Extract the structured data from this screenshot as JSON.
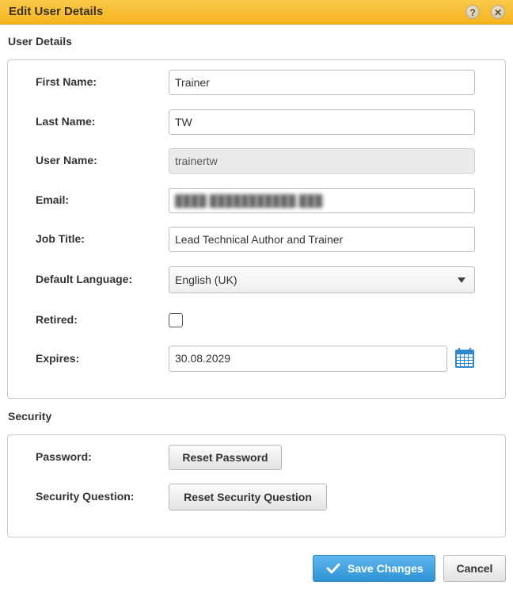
{
  "dialog": {
    "title": "Edit User Details",
    "help_glyph": "?",
    "close_glyph": "✕"
  },
  "user_details": {
    "heading": "User Details",
    "first_name": {
      "label": "First Name:",
      "value": "Trainer"
    },
    "last_name": {
      "label": "Last Name:",
      "value": "TW"
    },
    "user_name": {
      "label": "User Name:",
      "value": "trainertw"
    },
    "email": {
      "label": "Email:",
      "value": "████ ███████████.███"
    },
    "job_title": {
      "label": "Job Title:",
      "value": "Lead Technical Author and Trainer"
    },
    "default_language": {
      "label": "Default Language:",
      "value": "English (UK)"
    },
    "retired": {
      "label": "Retired:",
      "checked": false
    },
    "expires": {
      "label": "Expires:",
      "value": "30.08.2029"
    }
  },
  "security": {
    "heading": "Security",
    "password": {
      "label": "Password:",
      "button": "Reset Password"
    },
    "security_question": {
      "label": "Security Question:",
      "button": "Reset Security Question"
    }
  },
  "footer": {
    "save_label": "Save Changes",
    "cancel_label": "Cancel"
  },
  "colors": {
    "title_bar": "#f5b41e",
    "save_button": "#3a9ee0",
    "calendar_icon": "#2f88cc"
  },
  "icons": {
    "help": "help-icon",
    "close": "close-icon",
    "calendar": "calendar-icon",
    "save": "checkmark-icon"
  }
}
